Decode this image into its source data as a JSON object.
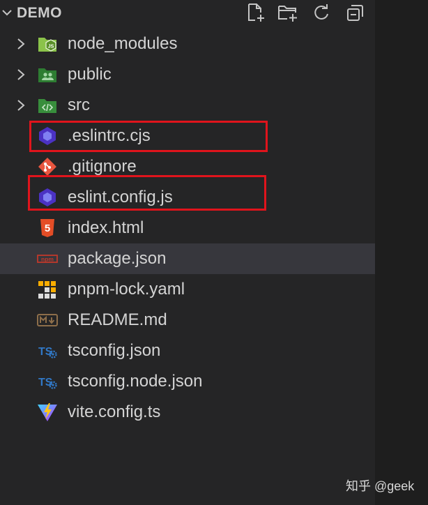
{
  "explorer": {
    "title": "DEMO",
    "toolbar": {
      "new_file_icon": "new-file-icon",
      "new_folder_icon": "new-folder-icon",
      "refresh_icon": "refresh-icon",
      "collapse_icon": "collapse-all-icon"
    },
    "items": [
      {
        "label": "node_modules",
        "kind": "folder",
        "icon": "folder-node-icon"
      },
      {
        "label": "public",
        "kind": "folder",
        "icon": "folder-public-icon"
      },
      {
        "label": "src",
        "kind": "folder",
        "icon": "folder-src-icon"
      },
      {
        "label": ".eslintrc.cjs",
        "kind": "file",
        "icon": "eslint-icon",
        "highlighted": true
      },
      {
        "label": ".gitignore",
        "kind": "file",
        "icon": "git-icon"
      },
      {
        "label": "eslint.config.js",
        "kind": "file",
        "icon": "eslint-icon",
        "highlighted": true
      },
      {
        "label": "index.html",
        "kind": "file",
        "icon": "html5-icon"
      },
      {
        "label": "package.json",
        "kind": "file",
        "icon": "npm-icon",
        "selected": true
      },
      {
        "label": "pnpm-lock.yaml",
        "kind": "file",
        "icon": "pnpm-icon"
      },
      {
        "label": "README.md",
        "kind": "file",
        "icon": "markdown-icon"
      },
      {
        "label": "tsconfig.json",
        "kind": "file",
        "icon": "tsconfig-icon"
      },
      {
        "label": "tsconfig.node.json",
        "kind": "file",
        "icon": "tsconfig-icon"
      },
      {
        "label": "vite.config.ts",
        "kind": "file",
        "icon": "vite-icon"
      }
    ]
  },
  "colors": {
    "highlight_box": "#e0141c",
    "selected_row": "#37373d"
  },
  "watermark": "知乎 @geek"
}
